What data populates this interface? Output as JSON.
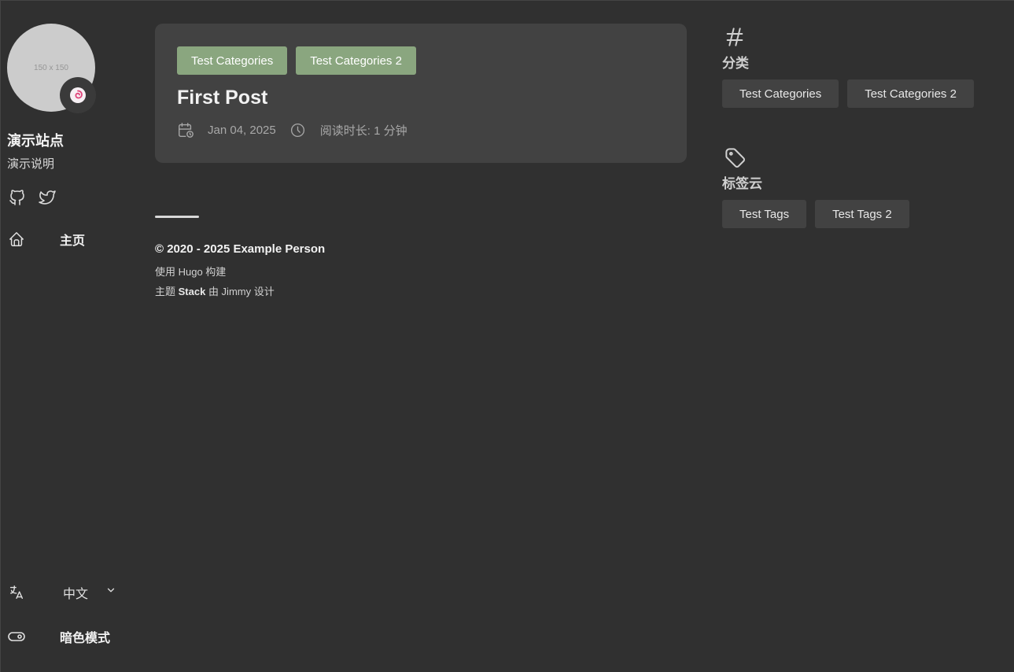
{
  "sidebar": {
    "avatar_placeholder": "150 x 150",
    "emoji_badge": "🍥",
    "site_name": "演示站点",
    "site_description": "演示说明",
    "social": [
      "github-icon",
      "twitter-icon"
    ],
    "menu": {
      "home_label": "主页",
      "language_label": "中文",
      "dark_mode_label": "暗色模式"
    }
  },
  "post": {
    "categories": [
      "Test Categories",
      "Test Categories 2"
    ],
    "title": "First Post",
    "date": "Jan 04, 2025",
    "reading_time": "阅读时长: 1 分钟"
  },
  "footer": {
    "copyright": "© 2020 - 2025 Example Person",
    "built_with": "使用 Hugo 构建",
    "theme_prefix": "主题 ",
    "theme_name": "Stack",
    "theme_suffix": " 由 Jimmy 设计"
  },
  "widgets": {
    "categories": {
      "title": "分类",
      "items": [
        "Test Categories",
        "Test Categories 2"
      ]
    },
    "tag_cloud": {
      "title": "标签云",
      "items": [
        "Test Tags",
        "Test Tags 2"
      ]
    }
  },
  "colors": {
    "background": "#303030",
    "card": "#424242",
    "category_tag": "#8aa67f"
  }
}
